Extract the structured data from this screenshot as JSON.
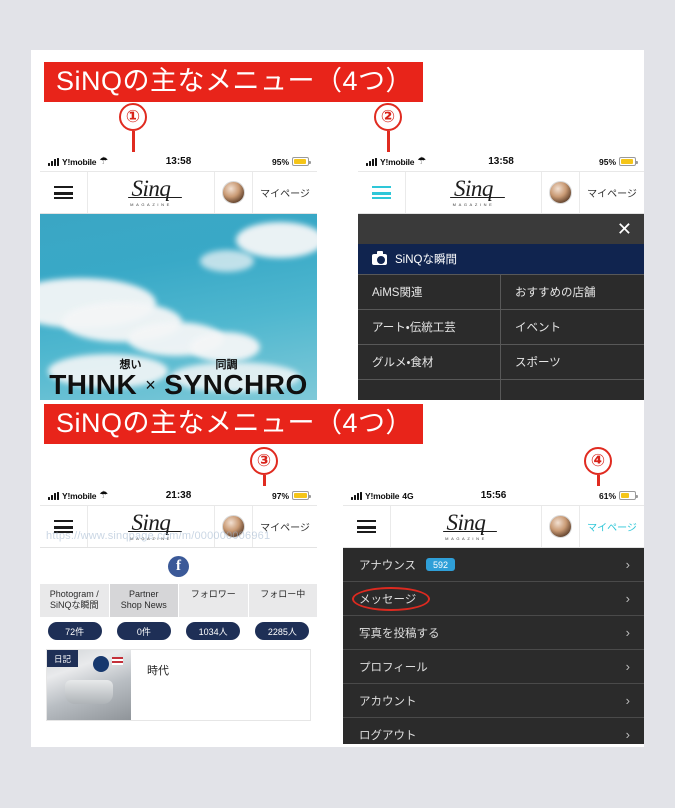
{
  "page": {
    "background_color": "#e2e3e8",
    "panel_color": "#ffffff"
  },
  "banners": {
    "accent_color": "#e8241a",
    "top_label": "SiNQの主なメニュー（4つ）",
    "bottom_label": "SiNQの主なメニュー（4つ）"
  },
  "markers": [
    {
      "label": "①",
      "points_to": "hamburger-menu-phone1"
    },
    {
      "label": "②",
      "points_to": "hamburger-menu-phone2"
    },
    {
      "label": "③",
      "points_to": "avatar-phone3"
    },
    {
      "label": "④",
      "points_to": "mypage-link-phone4"
    }
  ],
  "brand": {
    "logo_text": "Sinq",
    "logo_subtext": "MAGAZINE",
    "mypage_label": "マイページ",
    "cyan_color": "#2ec7d8",
    "navy_color": "#10244f"
  },
  "phone1": {
    "status": {
      "carrier": "Y!mobile",
      "network": "",
      "wifi_icon": "wifi-icon",
      "time": "13:58",
      "battery_percent": "95%"
    },
    "header": {
      "menu_icon": "hamburger-icon",
      "avatar": "user-avatar",
      "mypage_label": "マイページ"
    },
    "hero": {
      "ruby_left": "想い",
      "ruby_right": "同調",
      "headline_left": "THINK",
      "headline_x": "×",
      "headline_right": "SYNCHRO"
    }
  },
  "phone2": {
    "status": {
      "carrier": "Y!mobile",
      "network": "",
      "wifi_icon": "wifi-icon",
      "time": "13:58",
      "battery_percent": "95%"
    },
    "header": {
      "menu_icon": "hamburger-icon",
      "avatar": "user-avatar",
      "mypage_label": "マイページ"
    },
    "drawer": {
      "close_label": "✕",
      "section_icon": "camera-icon",
      "section_title": "SiNQな瞬間",
      "categories": [
        "AiMS関連",
        "おすすめの店舗",
        "アート・伝統工芸",
        "イベント",
        "グルメ・食材",
        "スポーツ"
      ]
    }
  },
  "phone3": {
    "status": {
      "carrier": "Y!mobile",
      "network": "",
      "wifi_icon": "wifi-icon",
      "time": "21:38",
      "battery_percent": "97%"
    },
    "header": {
      "menu_icon": "hamburger-icon",
      "avatar": "user-avatar",
      "mypage_label": "マイページ"
    },
    "url_overlay": "https://www.sinqpage.com/m/000000006961",
    "share_icon": "facebook-icon",
    "tabs": [
      {
        "label_line1": "Photogram /",
        "label_line2": "SiNQな瞬間",
        "count": "72件",
        "selected": false
      },
      {
        "label_line1": "Partner",
        "label_line2": "Shop News",
        "count": "0件",
        "selected": true
      },
      {
        "label_line1": "フォロワー",
        "label_line2": "",
        "count": "1034人",
        "selected": false
      },
      {
        "label_line1": "フォロー中",
        "label_line2": "",
        "count": "2285人",
        "selected": false
      }
    ],
    "post": {
      "badge": "日記",
      "title": "時代",
      "thumbnail": "astronaut-photo"
    }
  },
  "phone4": {
    "status": {
      "carrier": "Y!mobile",
      "network": "4G",
      "wifi_icon": "",
      "time": "15:56",
      "battery_percent": "61%"
    },
    "header": {
      "menu_icon": "hamburger-icon",
      "avatar": "user-avatar",
      "mypage_label": "マイページ"
    },
    "menu_items": [
      {
        "label": "アナウンス",
        "badge": "592",
        "highlighted": false
      },
      {
        "label": "メッセージ",
        "badge": "",
        "highlighted": true
      },
      {
        "label": "写真を投稿する",
        "badge": "",
        "highlighted": false
      },
      {
        "label": "プロフィール",
        "badge": "",
        "highlighted": false
      },
      {
        "label": "アカウント",
        "badge": "",
        "highlighted": false
      },
      {
        "label": "ログアウト",
        "badge": "",
        "highlighted": false
      }
    ],
    "chevron_icon": "chevron-right-icon"
  }
}
